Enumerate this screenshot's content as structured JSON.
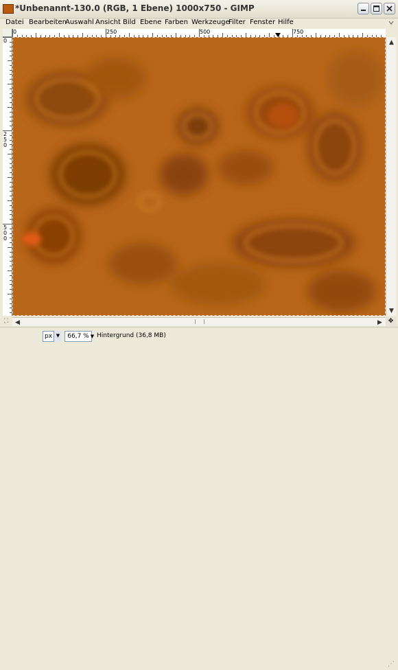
{
  "window": {
    "title": "*Unbenannt-130.0 (RGB, 1 Ebene) 1000x750 - GIMP"
  },
  "menu": [
    "Datei",
    "Bearbeiten",
    "Auswahl",
    "Ansicht",
    "Bild",
    "Ebene",
    "Farben",
    "Werkzeuge",
    "Filter",
    "Fenster",
    "Hilfe"
  ],
  "rulers": {
    "horizontal_labels": [
      "0",
      "250",
      "500",
      "750"
    ],
    "vertical_labels": [
      "0",
      "250",
      "500"
    ]
  },
  "status": {
    "unit": "px",
    "zoom": "66,7 %",
    "layer_info": "Hintergrund (36,8 MB)"
  },
  "colors": {
    "canvas_base": "#b86a1a",
    "canvas_dark": "#7a3a06",
    "canvas_light": "#d98a2a"
  }
}
